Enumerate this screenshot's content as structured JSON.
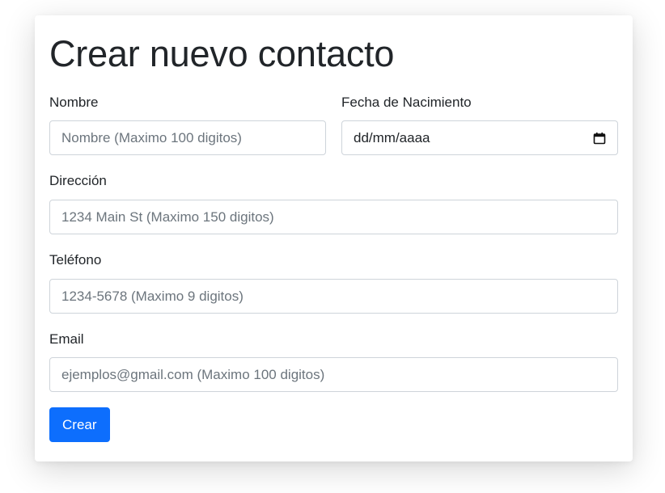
{
  "form": {
    "title": "Crear nuevo contacto",
    "nombre": {
      "label": "Nombre",
      "placeholder": "Nombre (Maximo 100 digitos)",
      "value": ""
    },
    "fecha": {
      "label": "Fecha de Nacimiento",
      "display": "dd/mm/aaaa",
      "icon": "calendar-icon"
    },
    "direccion": {
      "label": "Dirección",
      "placeholder": "1234 Main St (Maximo 150 digitos)",
      "value": ""
    },
    "telefono": {
      "label": "Teléfono",
      "placeholder": "1234-5678 (Maximo 9 digitos)",
      "value": ""
    },
    "email": {
      "label": "Email",
      "placeholder": "ejemplos@gmail.com (Maximo 100 digitos)",
      "value": ""
    },
    "submit_label": "Crear"
  },
  "colors": {
    "primary": "#0d6efd",
    "text": "#212529",
    "placeholder": "#6c757d",
    "border": "#ced4da"
  }
}
